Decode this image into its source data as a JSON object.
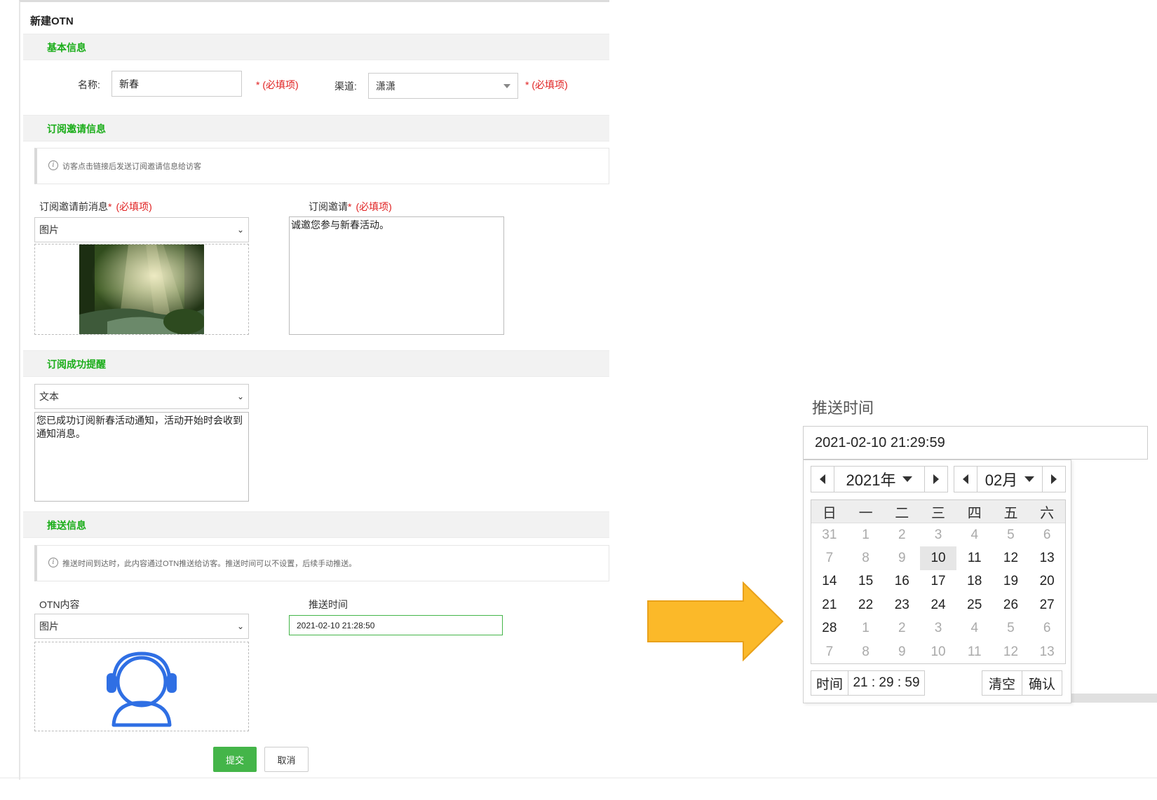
{
  "page": {
    "title": "新建OTN"
  },
  "sections": {
    "basic": "基本信息",
    "subscribe": "订阅邀请信息",
    "success": "订阅成功提醒",
    "push": "推送信息"
  },
  "basic": {
    "name_label": "名称:",
    "name_value": "新春",
    "required": "* (必填项)",
    "channel_label": "渠道:",
    "channel_value": "潇潇"
  },
  "subscribe": {
    "notice": "访客点击链接后发送订阅邀请信息给访客",
    "pre_msg_label": "订阅邀请前消息",
    "invite_label": "订阅邀请",
    "required_star": "*",
    "required_text": "(必填项)",
    "pre_msg_type": "图片",
    "invite_text": "诚邀您参与新春活动。"
  },
  "success": {
    "type": "文本",
    "text": "您已成功订阅新春活动通知，活动开始时会收到通知消息。"
  },
  "push": {
    "notice": "推送时间到达时，此内容通过OTN推送给访客。推送时间可以不设置，后续手动推送。",
    "otn_label": "OTN内容",
    "otn_type": "图片",
    "time_label": "推送时间",
    "time_value": "2021-02-10 21:28:50"
  },
  "buttons": {
    "submit": "提交",
    "cancel": "取消"
  },
  "datepicker": {
    "title": "推送时间",
    "value": "2021-02-10 21:29:59",
    "year": "2021年",
    "month": "02月",
    "weekdays": [
      "日",
      "一",
      "二",
      "三",
      "四",
      "五",
      "六"
    ],
    "weeks": [
      [
        {
          "d": "31",
          "m": true
        },
        {
          "d": "1",
          "m": true
        },
        {
          "d": "2",
          "m": true
        },
        {
          "d": "3",
          "m": true
        },
        {
          "d": "4",
          "m": true
        },
        {
          "d": "5",
          "m": true
        },
        {
          "d": "6",
          "m": true
        }
      ],
      [
        {
          "d": "7",
          "m": true
        },
        {
          "d": "8",
          "m": true
        },
        {
          "d": "9",
          "m": true
        },
        {
          "d": "10",
          "t": true
        },
        {
          "d": "11"
        },
        {
          "d": "12"
        },
        {
          "d": "13"
        }
      ],
      [
        {
          "d": "14"
        },
        {
          "d": "15"
        },
        {
          "d": "16"
        },
        {
          "d": "17"
        },
        {
          "d": "18"
        },
        {
          "d": "19"
        },
        {
          "d": "20"
        }
      ],
      [
        {
          "d": "21"
        },
        {
          "d": "22"
        },
        {
          "d": "23"
        },
        {
          "d": "24"
        },
        {
          "d": "25"
        },
        {
          "d": "26"
        },
        {
          "d": "27"
        }
      ],
      [
        {
          "d": "28"
        },
        {
          "d": "1",
          "m": true
        },
        {
          "d": "2",
          "m": true
        },
        {
          "d": "3",
          "m": true
        },
        {
          "d": "4",
          "m": true
        },
        {
          "d": "5",
          "m": true
        },
        {
          "d": "6",
          "m": true
        }
      ],
      [
        {
          "d": "7",
          "m": true
        },
        {
          "d": "8",
          "m": true
        },
        {
          "d": "9",
          "m": true
        },
        {
          "d": "10",
          "m": true
        },
        {
          "d": "11",
          "m": true
        },
        {
          "d": "12",
          "m": true
        },
        {
          "d": "13",
          "m": true
        }
      ]
    ],
    "time_label": "时间",
    "time_value": "21 : 29 : 59",
    "clear": "清空",
    "confirm": "确认"
  },
  "colors": {
    "accent": "#1aad19",
    "required": "#e02020",
    "primary_button": "#44b549",
    "arrow": "#fbb929",
    "icon_blue": "#2f6fe4"
  }
}
